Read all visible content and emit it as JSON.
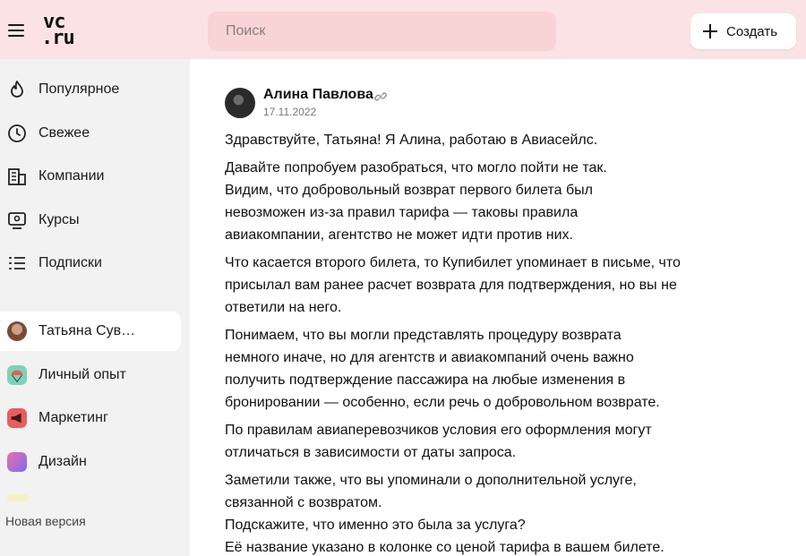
{
  "header": {
    "logo_line1": "vc",
    "logo_line2": ".ru",
    "search_placeholder": "Поиск",
    "create_label": "Создать"
  },
  "sidebar": {
    "items": [
      {
        "label": "Популярное",
        "icon": "flame-icon"
      },
      {
        "label": "Свежее",
        "icon": "clock-icon"
      },
      {
        "label": "Компании",
        "icon": "building-icon"
      },
      {
        "label": "Курсы",
        "icon": "course-icon"
      },
      {
        "label": "Подписки",
        "icon": "list-icon"
      }
    ],
    "subscriptions": [
      {
        "label": "Татьяна Сув…",
        "icon": "user-avatar",
        "active": true
      },
      {
        "label": "Личный опыт",
        "icon": "parachute-icon",
        "color": "#7dd3b8"
      },
      {
        "label": "Маркетинг",
        "icon": "megaphone-icon",
        "color": "#e85d5d"
      },
      {
        "label": "Дизайн",
        "icon": "design-icon",
        "color": "#a66cf0"
      }
    ],
    "new_version": "Новая версия"
  },
  "post": {
    "author": "Алина Павлова",
    "date": "17.11.2022",
    "paragraphs": [
      [
        "Здравствуйте, Татьяна! Я Алина, работаю в Авиасейлс."
      ],
      [
        "Давайте попробуем разобраться, что могло пойти не так.",
        "Видим, что добровольный возврат первого билета был",
        "невозможен из-за правил тарифа — таковы правила",
        "авиакомпании, агентство не может идти против них."
      ],
      [
        "Что касается второго билета, то Купибилет упоминает в письме, что",
        "присылал вам ранее расчет возврата для подтверждения, но вы не",
        "ответили на него."
      ],
      [
        "Понимаем, что вы могли представлять процедуру возврата",
        "немного иначе, но для агентств и авиакомпаний очень важно",
        "получить подтверждение пассажира на любые изменения в",
        "бронировании — особенно, если речь о добровольном возврате."
      ],
      [
        "По правилам авиаперевозчиков условия его оформления могут",
        "отличаться в зависимости от даты запроса."
      ],
      [
        "Заметили также, что вы упоминали о дополнительной услуге,",
        "связанной с возвратом.",
        "Подскажите, что именно это была за услуга?",
        "Её название указано в колонке со ценой тарифа в вашем билете."
      ]
    ]
  }
}
